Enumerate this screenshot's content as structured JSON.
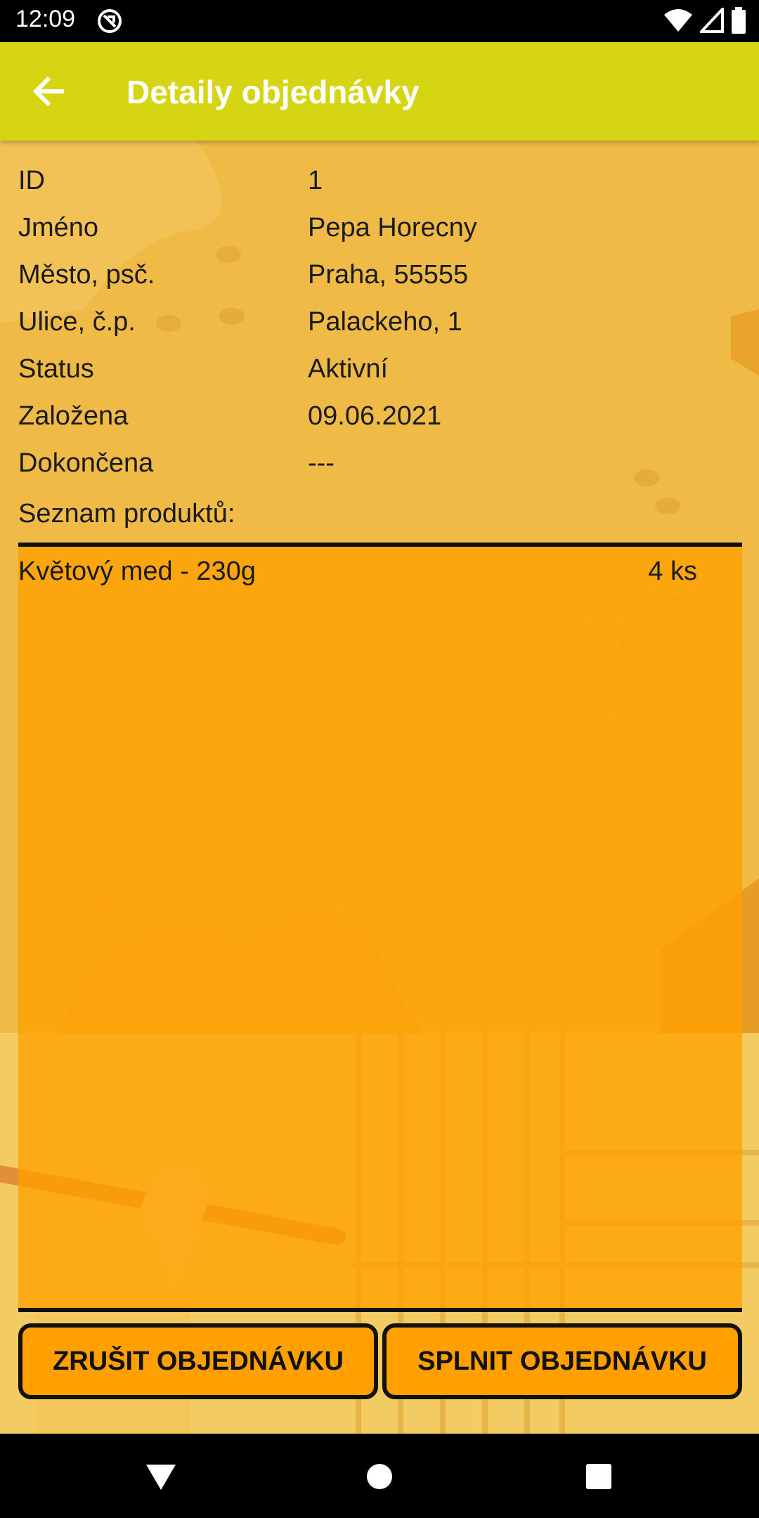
{
  "status_bar": {
    "time": "12:09"
  },
  "app_bar": {
    "title": "Detaily objednávky"
  },
  "order": {
    "rows": [
      {
        "label": "ID",
        "value": "1"
      },
      {
        "label": "Jméno",
        "value": "Pepa Horecny"
      },
      {
        "label": "Město, psč.",
        "value": "Praha, 55555"
      },
      {
        "label": "Ulice, č.p.",
        "value": "Palackeho, 1"
      },
      {
        "label": "Status",
        "value": "Aktivní"
      },
      {
        "label": "Založena",
        "value": "09.06.2021"
      },
      {
        "label": "Dokončena",
        "value": "---"
      }
    ]
  },
  "products": {
    "title": "Seznam produktů:",
    "items": [
      {
        "name": "Květový med - 230g",
        "qty": "4 ks"
      }
    ]
  },
  "buttons": {
    "cancel_label": "ZRUŠIT OBJEDNÁVKU",
    "complete_label": "SPLNIT OBJEDNÁVKU"
  },
  "colors": {
    "app_bar": "#D5D514",
    "background": "#EFBA45",
    "button": "#FFA000"
  },
  "icons": {
    "back": "arrow-left-icon",
    "nav_back": "triangle-back-icon",
    "nav_home": "circle-home-icon",
    "nav_recents": "square-recents-icon"
  }
}
